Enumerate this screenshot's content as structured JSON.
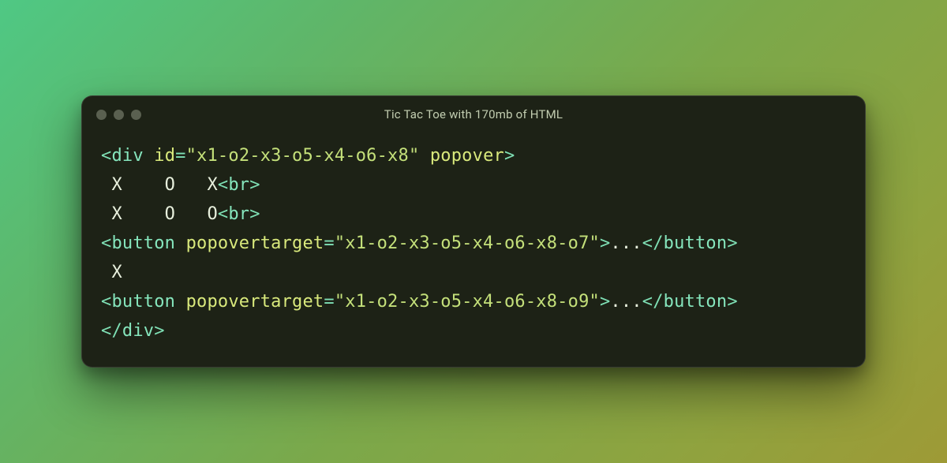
{
  "window": {
    "title": "Tic Tac Toe with 170mb of HTML"
  },
  "code": {
    "l1": {
      "open": "<",
      "tag": "div",
      "sp1": " ",
      "attr_id": "id",
      "eq": "=",
      "val_id": "\"x1-o2-x3-o5-x4-o6-x8\"",
      "sp2": " ",
      "attr_pop": "popover",
      "close": ">"
    },
    "l2": {
      "text": " X    O   X",
      "open": "<",
      "tag": "br",
      "close": ">"
    },
    "l3": {
      "text": " X    O   O",
      "open": "<",
      "tag": "br",
      "close": ">"
    },
    "l4": {
      "open": "<",
      "tag": "button",
      "sp": " ",
      "attr": "popovertarget",
      "eq": "=",
      "val": "\"x1-o2-x3-o5-x4-o6-x8-o7\"",
      "close": ">",
      "content": "...",
      "open2": "</",
      "tag2": "button",
      "close2": ">"
    },
    "l5": {
      "text": " X"
    },
    "l6": {
      "open": "<",
      "tag": "button",
      "sp": " ",
      "attr": "popovertarget",
      "eq": "=",
      "val": "\"x1-o2-x3-o5-x4-o6-x8-o9\"",
      "close": ">",
      "content": "...",
      "open2": "</",
      "tag2": "button",
      "close2": ">"
    },
    "l7": {
      "open": "</",
      "tag": "div",
      "close": ">"
    }
  }
}
